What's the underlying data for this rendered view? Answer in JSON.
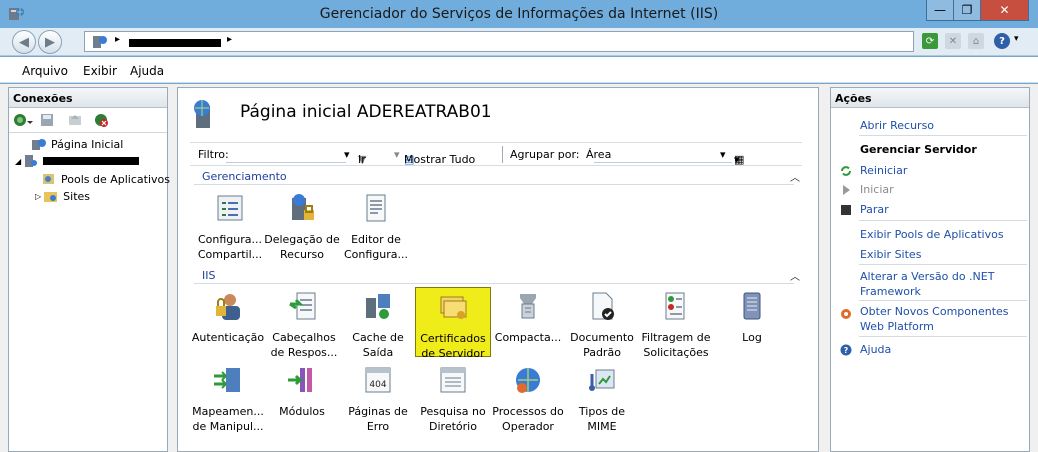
{
  "window": {
    "title": "Gerenciador do Serviços de Informações da Internet (IIS)",
    "min_glyph": "—",
    "max_glyph": "❐",
    "close_glyph": "✕"
  },
  "address": {
    "sep": "▸",
    "help_arrow": "▾",
    "help_glyph": "?"
  },
  "menu": {
    "items": [
      "Arquivo",
      "Exibir",
      "Ajuda"
    ]
  },
  "connections": {
    "title": "Conexões",
    "tree": {
      "home": "Página Inicial",
      "server_expander": "◢",
      "pools": "Pools de Aplicativos",
      "sites_expander": "▷",
      "sites": "Sites"
    }
  },
  "center": {
    "title": "Página inicial ADEREATRAB01",
    "filter": {
      "label": "Filtro:",
      "go": "Ir",
      "show_all": "Mostrar Tudo",
      "group_label": "Agrupar por:",
      "group_value": "Área",
      "dropdown_glyph": "▾"
    },
    "sections": [
      {
        "name": "Gerenciamento",
        "collapse_glyph": "︿",
        "features": [
          {
            "line1": "Configura...",
            "line2": "Compartil..."
          },
          {
            "line1": "Delegação de",
            "line2": "Recurso"
          },
          {
            "line1": "Editor de",
            "line2": "Configura..."
          }
        ]
      },
      {
        "name": "IIS",
        "collapse_glyph": "︿",
        "features": [
          {
            "line1": "Autenticação",
            "line2": ""
          },
          {
            "line1": "Cabeçalhos",
            "line2": "de Respos..."
          },
          {
            "line1": "Cache de",
            "line2": "Saída"
          },
          {
            "line1": "Certificados",
            "line2": "de Servidor"
          },
          {
            "line1": "Compacta...",
            "line2": ""
          },
          {
            "line1": "Documento",
            "line2": "Padrão"
          },
          {
            "line1": "Filtragem de",
            "line2": "Solicitações"
          },
          {
            "line1": "Log",
            "line2": ""
          },
          {
            "line1": "Mapeamen...",
            "line2": "de Manipul..."
          },
          {
            "line1": "Módulos",
            "line2": ""
          },
          {
            "line1": "Páginas de",
            "line2": "Erro"
          },
          {
            "line1": "Pesquisa no",
            "line2": "Diretório"
          },
          {
            "line1": "Processos do",
            "line2": "Operador"
          },
          {
            "line1": "Tipos de",
            "line2": "MIME"
          }
        ]
      }
    ]
  },
  "actions": {
    "title": "Ações",
    "open_feature": "Abrir Recurso",
    "manage_server": "Gerenciar Servidor",
    "restart": "Reiniciar",
    "start": "Iniciar",
    "stop": "Parar",
    "view_pools": "Exibir Pools de Aplicativos",
    "view_sites": "Exibir Sites",
    "change_net_1": "Alterar a Versão do .NET",
    "change_net_2": "Framework",
    "get_components_1": "Obter Novos Componentes",
    "get_components_2": "Web Platform",
    "help": "Ajuda"
  }
}
